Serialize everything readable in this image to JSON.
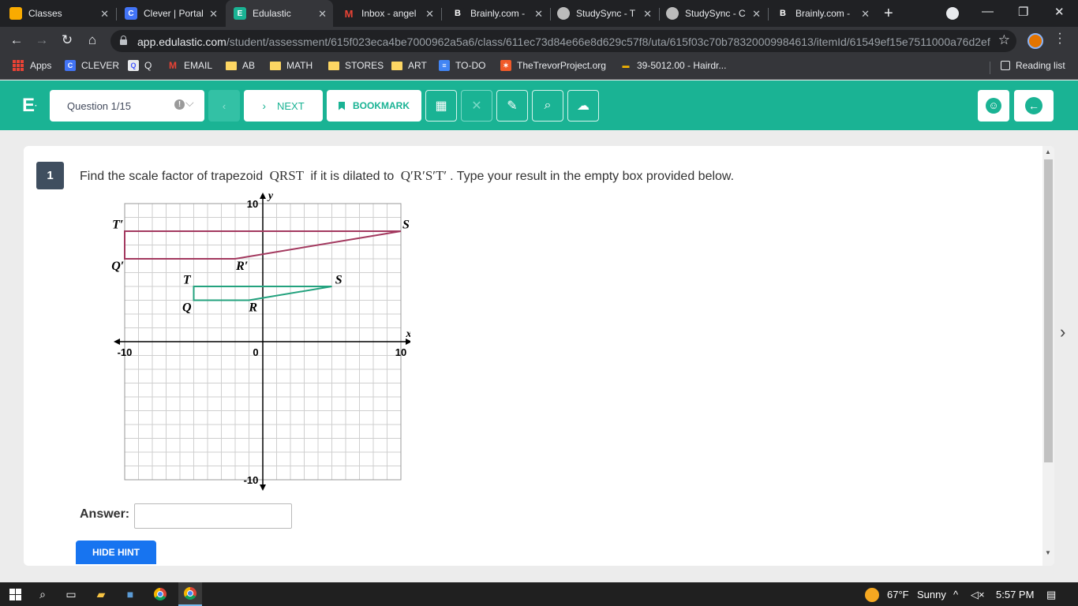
{
  "browser": {
    "tabs": [
      {
        "title": "Classes",
        "favicon": "google-classroom-icon",
        "favicon_color": "#f9ab00"
      },
      {
        "title": "Clever | Portal",
        "favicon": "clever-icon",
        "favicon_color": "#4274f6"
      },
      {
        "title": "Edulastic",
        "favicon": "edulastic-icon",
        "favicon_color": "#1ab394"
      },
      {
        "title": "Inbox - angel",
        "favicon": "gmail-icon",
        "favicon_color": "#ea4335"
      },
      {
        "title": "Brainly.com -",
        "favicon": "brainly-icon",
        "favicon_color": "#202124"
      },
      {
        "title": "StudySync - T",
        "favicon": "studysync-icon",
        "favicon_color": "#bbbbbb"
      },
      {
        "title": "StudySync - C",
        "favicon": "studysync-icon",
        "favicon_color": "#bbbbbb"
      },
      {
        "title": "Brainly.com -",
        "favicon": "brainly-icon",
        "favicon_color": "#202124"
      }
    ],
    "active_tab": 2,
    "url_host": "app.edulastic.com",
    "url_path": "/student/assessment/615f023eca4be7000962a5a6/class/611ec73d84e66e8d629c57f8/uta/615f03c70b78320009984613/itemId/61549ef15e7511000a76d2ef",
    "bookmarks": [
      {
        "label": "Apps",
        "icon": "apps-grid-icon"
      },
      {
        "label": "CLEVER",
        "icon": "clever-icon"
      },
      {
        "label": "Q",
        "icon": "quizlet-icon"
      },
      {
        "label": "EMAIL",
        "icon": "gmail-icon"
      },
      {
        "label": "AB",
        "icon": "folder-icon"
      },
      {
        "label": "MATH",
        "icon": "folder-icon"
      },
      {
        "label": "STORES",
        "icon": "folder-icon"
      },
      {
        "label": "ART",
        "icon": "folder-icon"
      },
      {
        "label": "TO-DO",
        "icon": "docs-icon"
      },
      {
        "label": "TheTrevorProject.org",
        "icon": "trevor-icon"
      },
      {
        "label": "39-5012.00 - Hairdr...",
        "icon": "onet-icon"
      }
    ],
    "reading_list": "Reading list"
  },
  "assessment": {
    "logo": "E",
    "question_select": "Question 1/15",
    "next_label": "NEXT",
    "bookmark_label": "BOOKMARK",
    "accent_color": "#1ab394",
    "tools": [
      "calculator-icon",
      "crossout-icon",
      "scratchpad-icon",
      "magnifier-icon",
      "upload-icon"
    ]
  },
  "question": {
    "number": "1",
    "text_before": "Find the scale factor of trapezoid",
    "shape_name": "QRST",
    "text_middle": "if it is dilated to",
    "image_name": "Q′R′S′T′",
    "text_after": ". Type your result in the empty box provided below.",
    "answer_label": "Answer:",
    "answer_value": "",
    "hint_button": "HIDE HINT"
  },
  "graph": {
    "x_label": "x",
    "y_label": "y",
    "tick_labels": {
      "x_min": "-10",
      "x_zero": "0",
      "x_max": "10",
      "y_max": "10",
      "y_min": "-10"
    },
    "range": [
      -10,
      10
    ],
    "polygons": [
      {
        "name": "QRST",
        "color": "#23a27e",
        "points": [
          [
            "Q",
            -5,
            3
          ],
          [
            "R",
            -1,
            3
          ],
          [
            "S",
            5,
            4
          ],
          [
            "T",
            -5,
            4
          ]
        ]
      },
      {
        "name": "Q′R′S′T′",
        "color": "#a3395f",
        "points": [
          [
            "Q′",
            -10,
            6
          ],
          [
            "R′",
            -2,
            6
          ],
          [
            "S′",
            10,
            8
          ],
          [
            "T′",
            -10,
            8
          ]
        ]
      }
    ],
    "vertex_labels": [
      {
        "text": "T′",
        "x": -10.5,
        "y": 8.5
      },
      {
        "text": "S′",
        "x": 10.5,
        "y": 8.5
      },
      {
        "text": "Q′",
        "x": -10.5,
        "y": 5.5
      },
      {
        "text": "R′",
        "x": -1.5,
        "y": 5.5
      },
      {
        "text": "T",
        "x": -5.5,
        "y": 4.5
      },
      {
        "text": "S",
        "x": 5.5,
        "y": 4.5
      },
      {
        "text": "Q",
        "x": -5.5,
        "y": 2.5
      },
      {
        "text": "R",
        "x": -0.7,
        "y": 2.5
      }
    ]
  },
  "taskbar": {
    "weather_temp": "67°F",
    "weather_cond": "Sunny",
    "time": "5:57 PM"
  }
}
